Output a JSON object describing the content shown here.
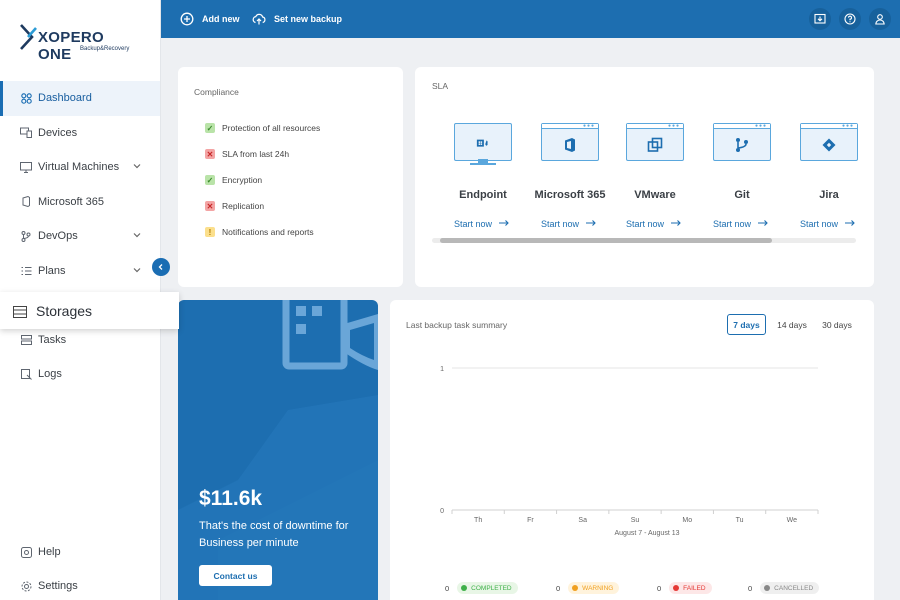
{
  "brand": {
    "name": "XOPERO ONE",
    "tagline": "Backup&Recovery"
  },
  "sidebar": {
    "items": [
      {
        "label": "Dashboard",
        "icon": "dashboard-icon",
        "active": true
      },
      {
        "label": "Devices",
        "icon": "devices-icon"
      },
      {
        "label": "Virtual Machines",
        "icon": "monitor-icon",
        "expandable": true
      },
      {
        "label": "Microsoft 365",
        "icon": "office-icon"
      },
      {
        "label": "DevOps",
        "icon": "git-branch-icon",
        "expandable": true
      },
      {
        "label": "Plans",
        "icon": "list-icon",
        "expandable": true
      },
      {
        "label": "Storages",
        "icon": "storage-icon"
      },
      {
        "label": "Tasks",
        "icon": "tasks-icon"
      },
      {
        "label": "Logs",
        "icon": "logs-icon"
      }
    ],
    "bottom": [
      {
        "label": "Help",
        "icon": "help-icon"
      },
      {
        "label": "Settings",
        "icon": "gear-icon"
      }
    ]
  },
  "topbar": {
    "add_new": "Add new",
    "set_new_backup": "Set new backup"
  },
  "compliance": {
    "title": "Compliance",
    "items": [
      {
        "label": "Protection of all resources",
        "status": "ok"
      },
      {
        "label": "SLA from last 24h",
        "status": "fail"
      },
      {
        "label": "Encryption",
        "status": "ok"
      },
      {
        "label": "Replication",
        "status": "fail"
      },
      {
        "label": "Notifications and reports",
        "status": "warn"
      }
    ]
  },
  "sla": {
    "title": "SLA",
    "link_label": "Start now",
    "items": [
      {
        "name": "Endpoint",
        "icon": "endpoint-icon"
      },
      {
        "name": "Microsoft 365",
        "icon": "office-icon"
      },
      {
        "name": "VMware",
        "icon": "vmware-icon"
      },
      {
        "name": "Git",
        "icon": "git-icon"
      },
      {
        "name": "Jira",
        "icon": "jira-icon"
      }
    ]
  },
  "promo": {
    "price": "$11.6k",
    "line1": "That's the cost of downtime for",
    "line2": "Business per minute",
    "button": "Contact us"
  },
  "summary": {
    "title": "Last backup task summary",
    "ranges": [
      "7 days",
      "14 days",
      "30 days"
    ],
    "active_range": "7 days",
    "statuses": [
      {
        "label": "COMPLETED",
        "count": "0",
        "color": "#3fb04a",
        "bg": "#e8f6e6"
      },
      {
        "label": "WARNING",
        "count": "0",
        "color": "#f0a020",
        "bg": "#fff3dc"
      },
      {
        "label": "FAILED",
        "count": "0",
        "color": "#e53935",
        "bg": "#fde7e7"
      },
      {
        "label": "CANCELLED",
        "count": "0",
        "color": "#888888",
        "bg": "#efefef"
      }
    ]
  },
  "chart_data": {
    "type": "bar",
    "title": "",
    "categories": [
      "Th",
      "Fr",
      "Sa",
      "Su",
      "Mo",
      "Tu",
      "We"
    ],
    "series": [
      {
        "values": [
          0,
          0,
          0,
          0,
          0,
          0,
          0
        ]
      }
    ],
    "xlabel": "August 7 - August 13",
    "ylabel": "",
    "ylim": [
      0,
      1
    ],
    "yticks": [
      "1",
      "0"
    ],
    "grid": true
  },
  "colors": {
    "primary": "#1d6eb0",
    "sidebar_active_bg": "#edf3fa"
  }
}
